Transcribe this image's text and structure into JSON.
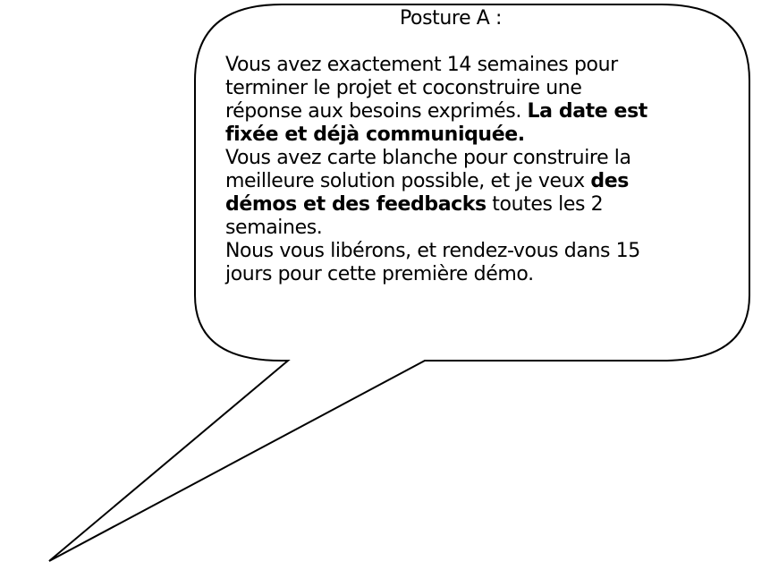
{
  "bubble": {
    "title": "Posture A :",
    "paragraph1": {
      "line1": "Vous avez exactement 14 semaines pour",
      "line2": "terminer le projet et coconstruire une",
      "line3_normal": "réponse aux besoins exprimés. ",
      "line3_bold": "La date est",
      "line4_bold": "fixée et déjà communiquée."
    },
    "paragraph2": {
      "line1": "Vous avez carte blanche pour construire la",
      "line2_normal": "meilleure solution possible, et je veux ",
      "line2_bold": "des",
      "line3_bold": "démos et des feedbacks",
      "line3_normal": " toutes les 2",
      "line4": "semaines."
    },
    "paragraph3": {
      "line1": "Nous vous libérons, et rendez-vous dans 15",
      "line2": "jours pour cette première démo."
    }
  },
  "colors": {
    "stroke": "#000000",
    "background": "#ffffff"
  }
}
